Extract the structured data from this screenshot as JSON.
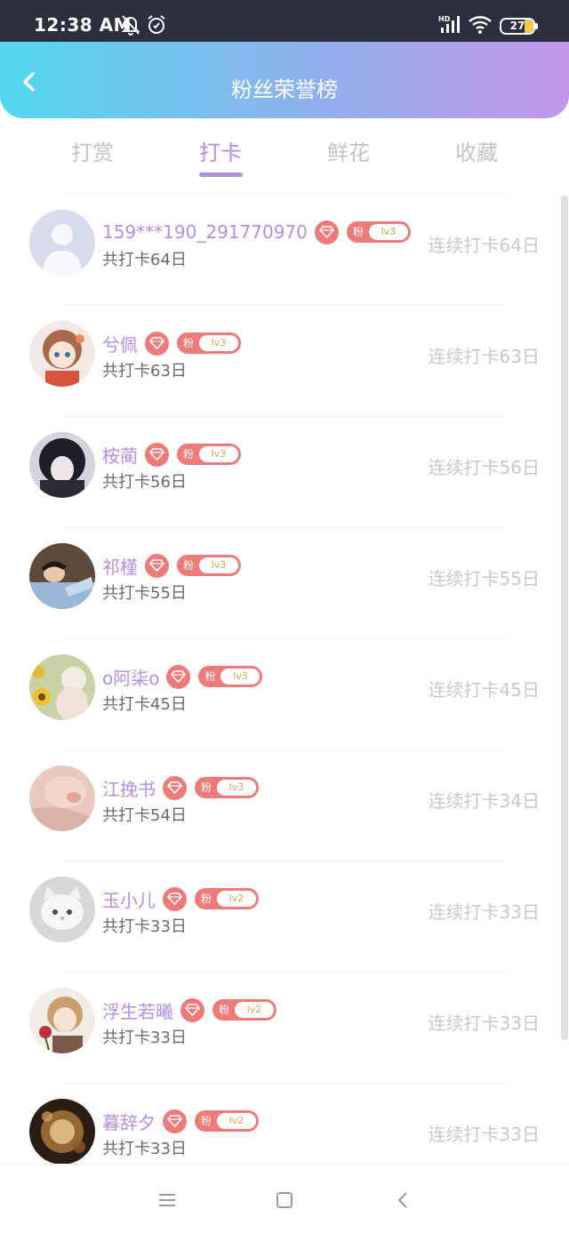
{
  "status_bar": {
    "time": "12:38 AM",
    "icons": [
      "mute-bell-icon",
      "alarm-icon",
      "hd-signal-icon",
      "wifi-icon"
    ],
    "battery_level": "27",
    "battery_color": "#f2c94c"
  },
  "header": {
    "title": "粉丝荣誉榜",
    "back_icon": "chevron-left-icon",
    "gradient": [
      "#52d7f2",
      "#c396ea"
    ]
  },
  "tabs": [
    {
      "label": "打赏",
      "active": false
    },
    {
      "label": "打卡",
      "active": true
    },
    {
      "label": "鲜花",
      "active": false
    },
    {
      "label": "收藏",
      "active": false
    }
  ],
  "badge": {
    "fan_text": "粉",
    "diamond_icon": "diamond-icon",
    "color": "#ee7a7a"
  },
  "accent_color": "#b48de4",
  "fans": [
    {
      "name": "159***190_291770970",
      "total": "共打卡64日",
      "streak": "连续打卡64日",
      "level": "lv3",
      "avatar": "default-avatar"
    },
    {
      "name": "兮佩",
      "total": "共打卡63日",
      "streak": "连续打卡63日",
      "level": "lv3",
      "avatar": "anime-girl-avatar"
    },
    {
      "name": "桉蔺",
      "total": "共打卡56日",
      "streak": "连续打卡56日",
      "level": "lv3",
      "avatar": "dark-anime-avatar"
    },
    {
      "name": "祁槿",
      "total": "共打卡55日",
      "streak": "连续打卡55日",
      "level": "lv3",
      "avatar": "boy-photo-avatar"
    },
    {
      "name": "o阿柒o",
      "total": "共打卡45日",
      "streak": "连续打卡45日",
      "level": "lv3",
      "avatar": "sunflower-avatar"
    },
    {
      "name": "江挽书",
      "total": "共打卡54日",
      "streak": "连续打卡34日",
      "level": "lv3",
      "avatar": "pig-plush-avatar"
    },
    {
      "name": "玉小儿",
      "total": "共打卡33日",
      "streak": "连续打卡33日",
      "level": "lv2",
      "avatar": "kitten-avatar"
    },
    {
      "name": "浮生若曦",
      "total": "共打卡33日",
      "streak": "连续打卡33日",
      "level": "lv2",
      "avatar": "anime-rose-avatar"
    },
    {
      "name": "暮辞夕",
      "total": "共打卡33日",
      "streak": "连续打卡33日",
      "level": "lv2",
      "avatar": "golden-art-avatar"
    }
  ],
  "nav_bar": {
    "buttons": [
      "menu-icon",
      "home-square-icon",
      "back-triangle-icon"
    ]
  }
}
